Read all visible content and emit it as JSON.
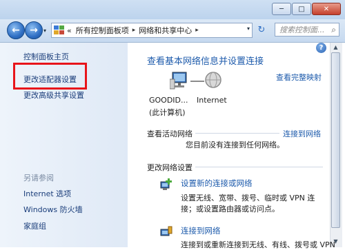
{
  "window": {
    "minimize": "─",
    "maximize": "□",
    "close": "✕"
  },
  "nav": {
    "back_icon": "arrow-left-icon",
    "forward_icon": "arrow-right-icon",
    "back_glyph": "←",
    "forward_glyph": "→",
    "dropdown_glyph": "▾",
    "breadcrumb_prefix": "«",
    "breadcrumbs": [
      "所有控制面板项",
      "网络和共享中心"
    ],
    "separator": "▸",
    "refresh_glyph": "↻",
    "search_placeholder": "搜索控制面...",
    "search_glyph": "⌕"
  },
  "sidebar": {
    "items": [
      {
        "label": "控制面板主页"
      },
      {
        "label": "更改适配器设置"
      },
      {
        "label": "更改高级共享设置"
      }
    ],
    "see_also_title": "另请参阅",
    "see_also": [
      {
        "label": "Internet 选项"
      },
      {
        "label": "Windows 防火墙"
      },
      {
        "label": "家庭组"
      }
    ]
  },
  "main": {
    "help_glyph": "?",
    "title": "查看基本网络信息并设置连接",
    "full_map_link": "查看完整映射",
    "computer_name": "GOODID...",
    "computer_sub": "(此计算机)",
    "internet_label": "Internet",
    "active_networks_head": "查看活动网络",
    "connect_link": "连接到网络",
    "no_network_text": "您目前没有连接到任何网络。",
    "change_settings_head": "更改网络设置",
    "tasks": [
      {
        "title": "设置新的连接或网络",
        "desc_line1": "设置无线、宽带、拨号、临时或 VPN 连",
        "desc_line2": "接；或设置路由器或访问点。"
      },
      {
        "title": "连接到网络",
        "desc_line1": "连接到或重新连接到无线、有线、拨号或 VPN"
      }
    ]
  },
  "scrollbar": {
    "up_glyph": "▲",
    "down_glyph": "▼"
  },
  "colors": {
    "link": "#1c5aab",
    "highlight_box": "#e8141a"
  }
}
